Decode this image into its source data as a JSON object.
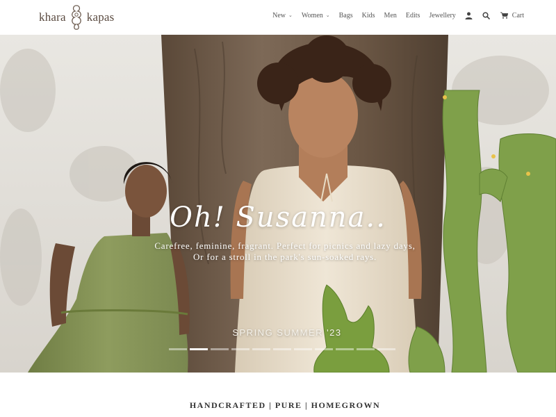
{
  "brand": {
    "left": "khara",
    "right": "kapas"
  },
  "nav": {
    "items": [
      {
        "label": "New",
        "dropdown": true
      },
      {
        "label": "Women",
        "dropdown": true
      },
      {
        "label": "Bags",
        "dropdown": false
      },
      {
        "label": "Kids",
        "dropdown": false
      },
      {
        "label": "Men",
        "dropdown": false
      },
      {
        "label": "Edits",
        "dropdown": false
      },
      {
        "label": "Jewellery",
        "dropdown": false
      }
    ],
    "account_icon": "user-icon",
    "search_icon": "search-icon",
    "cart_icon": "cart-icon",
    "cart_label": "Cart"
  },
  "hero": {
    "title": "Oh! Susanna..",
    "subtitle_line1": "Carefree, feminine, fragrant. Perfect for picnics and lazy days,",
    "subtitle_line2": "Or for a stroll in the park's sun-soaked rays.",
    "season": "SPRING SUMMER '23",
    "slides_count": 11,
    "active_slide": 2
  },
  "tagline": "HANDCRAFTED | PURE | HOMEGROWN",
  "colors": {
    "dress_green": "#8d9a5c",
    "dress_cream": "#ede3d2",
    "tree_trunk": "#6e5a48",
    "cactus": "#7fa04a"
  }
}
